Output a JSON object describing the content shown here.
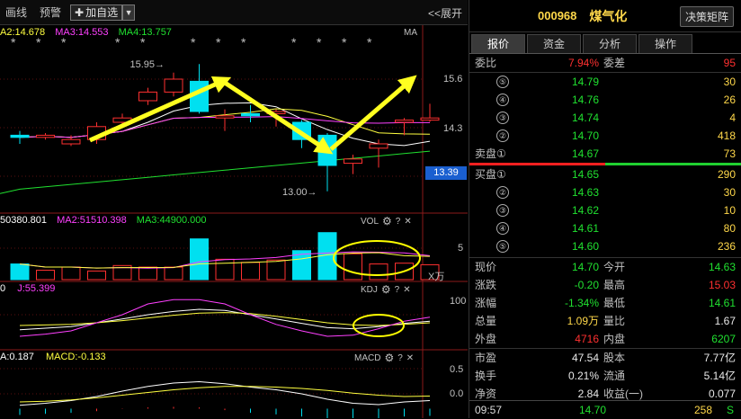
{
  "toolbar": {
    "draw_line": "画线",
    "alert": "预警",
    "add_watch": "加自选",
    "expand": "<<展开"
  },
  "main_legend": {
    "ma2": "A2:14.678",
    "ma3": "MA3:14.553",
    "ma4": "MA4:13.757",
    "tag": "MA"
  },
  "vol_legend": {
    "v1": "50380.801",
    "ma2": "MA2:51510.398",
    "ma3": "MA3:44900.000",
    "tag": "VOL",
    "scale": "5",
    "unit": "X万"
  },
  "kdj_legend": {
    "k": "0",
    "j": "J:55.399",
    "tag": "KDJ",
    "scale": "100"
  },
  "macd_legend": {
    "a": "A:0.187",
    "macd": "MACD:-0.133",
    "tag": "MACD",
    "s1": "0.5",
    "s2": "0.0"
  },
  "price_axis": {
    "p1": "15.6",
    "p2": "14.3",
    "current": "13.39",
    "high_mark": "15.95",
    "low_mark": "13.00"
  },
  "stars": "*",
  "colors": {
    "up": "#ff3030",
    "down": "#00e0f0",
    "ma1": "#ffffff",
    "ma2": "#ffff40",
    "ma3": "#ff40ff",
    "ma4": "#20e030",
    "arrow": "#ffff20",
    "highlight": "#ffff00"
  },
  "chart_data": {
    "type": "candlestick",
    "price_range": [
      12.6,
      16.6
    ],
    "candles": [
      {
        "o": 14.3,
        "c": 14.25,
        "h": 14.4,
        "l": 14.1
      },
      {
        "o": 14.25,
        "c": 14.3,
        "h": 14.35,
        "l": 14.2
      },
      {
        "o": 14.1,
        "c": 14.2,
        "h": 14.3,
        "l": 14.05
      },
      {
        "o": 14.2,
        "c": 14.5,
        "h": 14.6,
        "l": 14.1
      },
      {
        "o": 14.6,
        "c": 14.7,
        "h": 14.8,
        "l": 14.5
      },
      {
        "o": 15.1,
        "c": 15.3,
        "h": 15.4,
        "l": 15.0
      },
      {
        "o": 15.3,
        "c": 15.6,
        "h": 15.75,
        "l": 15.2
      },
      {
        "o": 15.55,
        "c": 14.85,
        "h": 15.95,
        "l": 14.8
      },
      {
        "o": 14.7,
        "c": 14.75,
        "h": 14.9,
        "l": 14.4
      },
      {
        "o": 14.8,
        "c": 14.75,
        "h": 15.0,
        "l": 14.6
      },
      {
        "o": 14.8,
        "c": 14.85,
        "h": 14.9,
        "l": 14.5
      },
      {
        "o": 14.6,
        "c": 14.2,
        "h": 14.65,
        "l": 14.0
      },
      {
        "o": 14.3,
        "c": 13.6,
        "h": 14.35,
        "l": 13.0
      },
      {
        "o": 13.65,
        "c": 13.75,
        "h": 13.85,
        "l": 13.4
      },
      {
        "o": 14.0,
        "c": 14.1,
        "h": 14.2,
        "l": 13.55
      },
      {
        "o": 14.6,
        "c": 14.65,
        "h": 14.7,
        "l": 14.3
      },
      {
        "o": 14.65,
        "c": 14.7,
        "h": 15.03,
        "l": 14.61
      }
    ],
    "volume": [
      2.0,
      1.2,
      1.6,
      1.1,
      1.8,
      1.6,
      1.6,
      5.2,
      2.6,
      2.2,
      2.5,
      3.7,
      6.0,
      3.3,
      2.0,
      2.1,
      1.9
    ],
    "volume_up": [
      false,
      true,
      true,
      true,
      true,
      true,
      true,
      false,
      true,
      true,
      true,
      false,
      false,
      true,
      true,
      true,
      true
    ],
    "volume_max": 7,
    "kdj_range": [
      0,
      100
    ],
    "kdj": {
      "k": [
        32,
        35,
        38,
        45,
        52,
        60,
        66,
        70,
        68,
        60,
        52,
        44,
        36,
        34,
        38,
        44,
        48
      ],
      "d": [
        40,
        41,
        42,
        45,
        49,
        54,
        59,
        63,
        64,
        62,
        57,
        51,
        45,
        41,
        40,
        42,
        45
      ],
      "j": [
        20,
        24,
        30,
        45,
        60,
        80,
        88,
        88,
        80,
        60,
        42,
        30,
        20,
        22,
        34,
        48,
        55.399
      ]
    },
    "macd": {
      "dif": [
        0.05,
        0.08,
        0.12,
        0.18,
        0.26,
        0.33,
        0.38,
        0.4,
        0.37,
        0.32,
        0.28,
        0.22,
        0.14,
        0.08,
        0.06,
        0.1,
        0.12
      ],
      "dea": [
        0.1,
        0.11,
        0.13,
        0.16,
        0.2,
        0.24,
        0.28,
        0.31,
        0.33,
        0.33,
        0.32,
        0.3,
        0.27,
        0.23,
        0.2,
        0.18,
        0.187
      ],
      "range": [
        -0.1,
        0.7
      ]
    }
  },
  "quote": {
    "code": "000968",
    "name": "煤气化",
    "strategy_btn": "决策矩阵",
    "tabs": [
      "报价",
      "资金",
      "分析",
      "操作"
    ],
    "weibi_label": "委比",
    "weibi_val": "7.94%",
    "weicha_label": "委差",
    "weicha_val": "95",
    "sell": [
      {
        "n": "⑤",
        "p": "14.79",
        "v": "30"
      },
      {
        "n": "④",
        "p": "14.76",
        "v": "26"
      },
      {
        "n": "③",
        "p": "14.74",
        "v": "4"
      },
      {
        "n": "②",
        "p": "14.70",
        "v": "418"
      }
    ],
    "sell1_label": "卖盘①",
    "sell1_p": "14.67",
    "sell1_v": "73",
    "buy1_label": "买盘①",
    "buy1_p": "14.65",
    "buy1_v": "290",
    "buy": [
      {
        "n": "②",
        "p": "14.63",
        "v": "30"
      },
      {
        "n": "③",
        "p": "14.62",
        "v": "10"
      },
      {
        "n": "④",
        "p": "14.61",
        "v": "80"
      },
      {
        "n": "⑤",
        "p": "14.60",
        "v": "236"
      }
    ],
    "stats": [
      {
        "l1": "现价",
        "v1": "14.70",
        "c1": "green",
        "l2": "今开",
        "v2": "14.63",
        "c2": "green"
      },
      {
        "l1": "涨跌",
        "v1": "-0.20",
        "c1": "green",
        "l2": "最高",
        "v2": "15.03",
        "c2": "red"
      },
      {
        "l1": "涨幅",
        "v1": "-1.34%",
        "c1": "green",
        "l2": "最低",
        "v2": "14.61",
        "c2": "green"
      },
      {
        "l1": "总量",
        "v1": "1.09万",
        "c1": "yellow",
        "l2": "量比",
        "v2": "1.67",
        "c2": "white"
      },
      {
        "l1": "外盘",
        "v1": "4716",
        "c1": "red",
        "l2": "内盘",
        "v2": "6207",
        "c2": "green"
      }
    ],
    "stats2": [
      {
        "l1": "市盈",
        "v1": "47.54",
        "l2": "股本",
        "v2": "7.77亿"
      },
      {
        "l1": "换手",
        "v1": "0.21%",
        "l2": "流通",
        "v2": "5.14亿"
      },
      {
        "l1": "净资",
        "v1": "2.84",
        "l2": "收益(一)",
        "v2": "0.077"
      }
    ],
    "tick_time": "09:57",
    "tick_price": "14.70",
    "tick_vol": "258",
    "tick_side": "S"
  }
}
